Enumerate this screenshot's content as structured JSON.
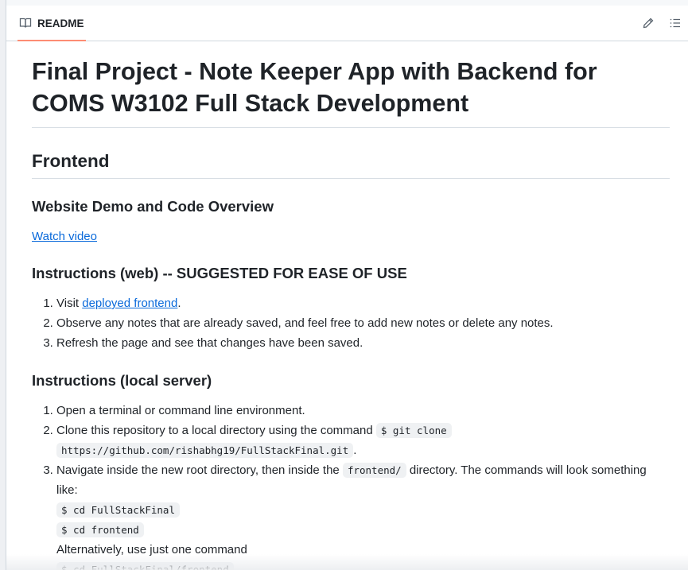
{
  "header": {
    "tab_label": "README",
    "icons": [
      "book-icon",
      "pencil-icon",
      "list-icon"
    ]
  },
  "content": {
    "title": "Final Project - Note Keeper App with Backend for COMS W3102 Full Stack Development",
    "frontend_heading": "Frontend",
    "demo_heading": "Website Demo and Code Overview",
    "watch_video_link": "Watch video",
    "web_heading": "Instructions (web) -- SUGGESTED FOR EASE OF USE",
    "web_steps": {
      "s1_prefix": "Visit ",
      "s1_link": "deployed frontend",
      "s1_suffix": ".",
      "s2": "Observe any notes that are already saved, and feel free to add new notes or delete any notes.",
      "s3": "Refresh the page and see that changes have been saved."
    },
    "local_heading": "Instructions (local server)",
    "local_steps": {
      "s1": "Open a terminal or command line environment.",
      "s2_prefix": "Clone this repository to a local directory using the command ",
      "s2_code1": "$ git clone",
      "s2_code2": "https://github.com/rishabhg19/FullStackFinal.git",
      "s2_suffix": ".",
      "s3_prefix": "Navigate inside the new root directory, then inside the ",
      "s3_code": "frontend/",
      "s3_suffix": " directory. The commands will look something like:",
      "s3_cmd1": "$ cd FullStackFinal",
      "s3_cmd2": "$ cd frontend",
      "s3_alt": "Alternatively, use just one command",
      "s3_cmd3": "$ cd FullStackFinal/frontend"
    }
  },
  "colors": {
    "link": "#0969da",
    "tab_underline": "#fd8c73",
    "code_bg": "#eff1f3",
    "border": "#d0d7de"
  }
}
